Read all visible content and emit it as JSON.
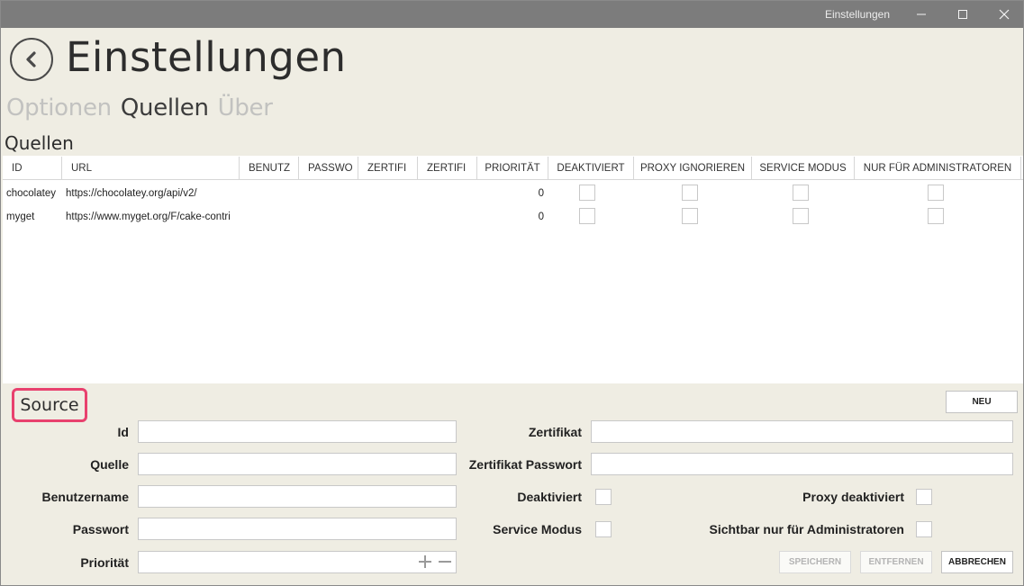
{
  "window": {
    "title": "Einstellungen"
  },
  "header": {
    "title": "Einstellungen"
  },
  "tabs": [
    {
      "label": "Optionen",
      "active": false
    },
    {
      "label": "Quellen",
      "active": true
    },
    {
      "label": "Über",
      "active": false
    }
  ],
  "section": {
    "title": "Quellen"
  },
  "grid": {
    "columns": [
      "ID",
      "URL",
      "BENUTZ",
      "PASSWO",
      "ZERTIFI",
      "ZERTIFI",
      "PRIORITÄT",
      "DEAKTIVIERT",
      "PROXY IGNORIEREN",
      "SERVICE MODUS",
      "NUR FÜR ADMINISTRATOREN"
    ],
    "rows": [
      {
        "id": "chocolatey",
        "url": "https://chocolatey.org/api/v2/",
        "priority": "0",
        "deaktiviert": false,
        "proxy": false,
        "service": false,
        "admin": false
      },
      {
        "id": "myget",
        "url": "https://www.myget.org/F/cake-contri",
        "priority": "0",
        "deaktiviert": false,
        "proxy": false,
        "service": false,
        "admin": false
      }
    ]
  },
  "form": {
    "title": "Source",
    "new_button": "NEU",
    "labels": {
      "id": "Id",
      "quelle": "Quelle",
      "benutzername": "Benutzername",
      "passwort": "Passwort",
      "prioritaet": "Priorität",
      "zertifikat": "Zertifikat",
      "zertifikat_passwort": "Zertifikat Passwort",
      "deaktiviert": "Deaktiviert",
      "service_modus": "Service Modus",
      "proxy_deaktiviert": "Proxy deaktiviert",
      "sichtbar_admin": "Sichtbar nur für Administratoren"
    },
    "values": {
      "id": "",
      "quelle": "",
      "benutzername": "",
      "passwort": "",
      "prioritaet": "",
      "zertifikat": "",
      "zertifikat_passwort": ""
    },
    "buttons": {
      "save": "SPEICHERN",
      "remove": "ENTFERNEN",
      "cancel": "ABBRECHEN"
    }
  },
  "colors": {
    "background": "#efede3",
    "titlebar": "#7c7c7c",
    "highlight": "#e8416e"
  }
}
